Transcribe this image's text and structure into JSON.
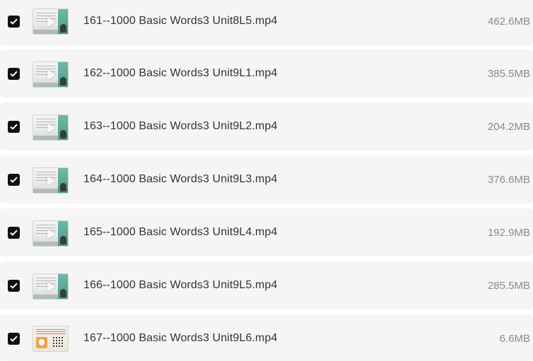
{
  "files": [
    {
      "name": "161--1000 Basic Words3 Unit8L5.mp4",
      "size": "462.6MB",
      "checked": true,
      "thumb": "video-thumbnail"
    },
    {
      "name": "162--1000 Basic Words3 Unit9L1.mp4",
      "size": "385.5MB",
      "checked": true,
      "thumb": "video-thumbnail"
    },
    {
      "name": "163--1000 Basic Words3 Unit9L2.mp4",
      "size": "204.2MB",
      "checked": true,
      "thumb": "video-thumbnail"
    },
    {
      "name": "164--1000 Basic Words3 Unit9L3.mp4",
      "size": "376.6MB",
      "checked": true,
      "thumb": "video-thumbnail"
    },
    {
      "name": "165--1000 Basic Words3 Unit9L4.mp4",
      "size": "192.9MB",
      "checked": true,
      "thumb": "video-thumbnail"
    },
    {
      "name": "166--1000 Basic Words3 Unit9L5.mp4",
      "size": "285.5MB",
      "checked": true,
      "thumb": "video-thumbnail"
    },
    {
      "name": "167--1000 Basic Words3 Unit9L6.mp4",
      "size": "6.6MB",
      "checked": true,
      "thumb": "document-thumbnail"
    }
  ],
  "colors": {
    "row_background": "#f5f5f6",
    "checkbox_fill": "#111111",
    "file_name_text": "#333333",
    "file_size_text": "#8a8a8a"
  }
}
